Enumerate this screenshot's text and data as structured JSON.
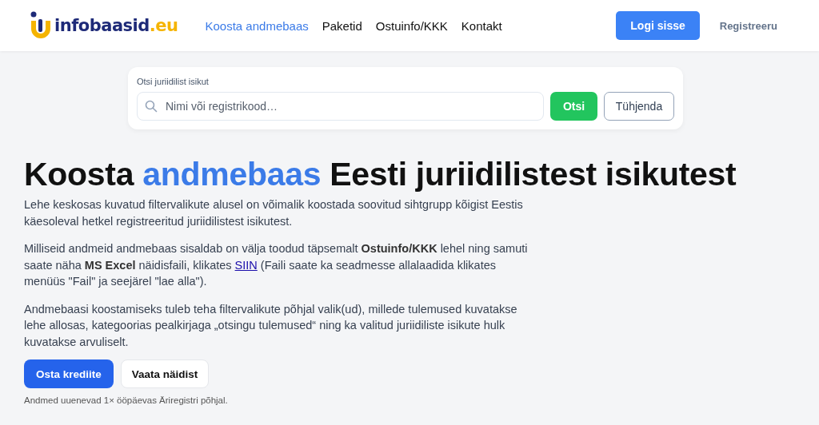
{
  "header": {
    "logo": {
      "name": "infobaasid",
      "tld": ".eu"
    },
    "nav": [
      {
        "label": "Koosta andmebaas",
        "selected": true
      },
      {
        "label": "Paketid",
        "selected": false
      },
      {
        "label": "Ostuinfo/KKK",
        "selected": false
      },
      {
        "label": "Kontakt",
        "selected": false
      }
    ],
    "login_button": "Logi sisse",
    "register_link": "Registreeru"
  },
  "search": {
    "label": "Otsi juriidilist isikut",
    "placeholder": "Nimi või registrikood…",
    "search_button": "Otsi",
    "clear_button": "Tühjenda"
  },
  "hero": {
    "title": [
      {
        "text": "Koosta ",
        "highlight": false
      },
      {
        "text": "andmebaas",
        "highlight": true
      },
      {
        "text": " Eesti juriidilistest isikutest",
        "highlight": false
      }
    ],
    "paragraphs": [
      {
        "text": "Lehe keskosas kuvatud filtervalikute alusel on võimalik koostada soovitud sihtgrupp kõigist Eestis käesoleval hetkel registreeritud juriidilistest isikutest."
      },
      {
        "text": "Milliseid andmeid andmebaas sisaldab on välja toodud täpsemalt **Ostuinfo/KKK** lehel ning samuti saate näha **MS Excel** näidisfaili, klikates ",
        "link": "SIIN",
        "after": " (Faili saate ka seadmesse allalaadida klikates menüüs \"Fail\" ja seejärel \"lae alla\")."
      },
      {
        "text": "Andmebaasi koostamiseks tuleb teha filtervalikute põhjal valik(ud), millede tulemused kuvatakse lehe allosas, kategoorias pealkirjaga „otsingu tulemused“ ning ka valitud juriidiliste isikute hulk kuvatakse arvuliselt."
      }
    ],
    "primary_button": "Osta krediite",
    "secondary_button": "Vaata näidist",
    "note": "Andmed uuenevad 1× ööpäevas Äriregistri põhjal."
  }
}
